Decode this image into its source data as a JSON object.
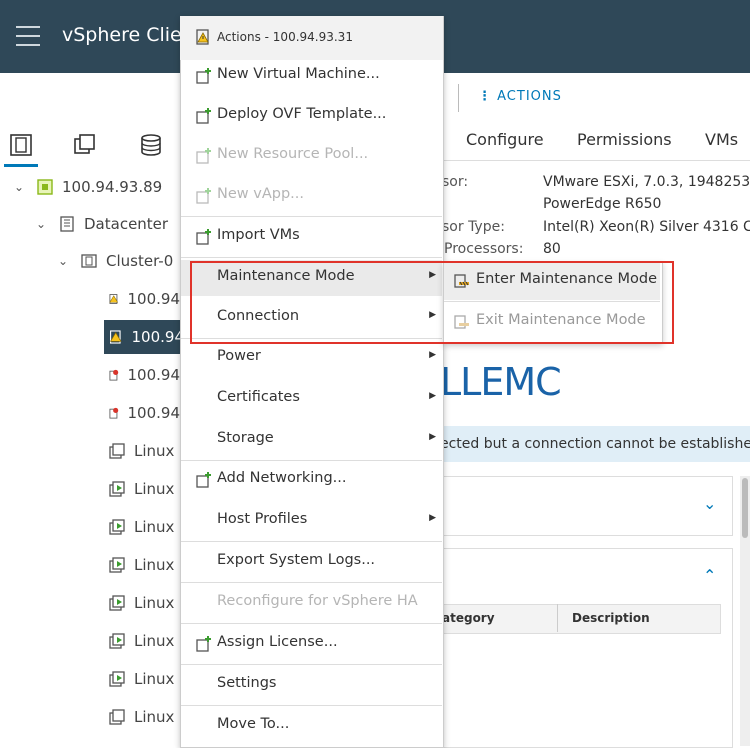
{
  "header": {
    "app_title": "vSphere Clier",
    "menu_icon": "hamburger-icon"
  },
  "navigator": {
    "icons": [
      "hosts-and-clusters-icon",
      "vms-and-templates-icon",
      "storage-icon"
    ],
    "tree": [
      {
        "label": "100.94.93.89",
        "icon": "vcenter-icon"
      },
      {
        "label": "Datacenter",
        "icon": "datacenter-icon"
      },
      {
        "label": "Cluster-0",
        "icon": "cluster-icon"
      },
      {
        "label": "100.94",
        "icon": "host-warning-icon"
      },
      {
        "label": "100.94",
        "icon": "host-warning-icon",
        "selected": true
      },
      {
        "label": "100.94",
        "icon": "host-error-icon"
      },
      {
        "label": "100.94",
        "icon": "host-error-icon"
      },
      {
        "label": "Linux",
        "icon": "vm-icon"
      },
      {
        "label": "Linux",
        "icon": "vm-running-icon"
      },
      {
        "label": "Linux",
        "icon": "vm-running-icon"
      },
      {
        "label": "Linux",
        "icon": "vm-running-icon"
      },
      {
        "label": "Linux",
        "icon": "vm-running-icon"
      },
      {
        "label": "Linux",
        "icon": "vm-running-icon"
      },
      {
        "label": "Linux",
        "icon": "vm-running-icon"
      },
      {
        "label": "Linux",
        "icon": "vm-icon"
      }
    ]
  },
  "main": {
    "actions_label": "ACTIONS",
    "tabs": [
      "Configure",
      "Permissions",
      "VMs"
    ],
    "summary": {
      "hypervisor_label": "sor:",
      "hypervisor_value": "VMware ESXi, 7.0.3, 1948253",
      "model_value": "PowerEdge R650",
      "processor_type_label": "sor Type:",
      "processor_type_value": "Intel(R) Xeon(R) Silver 4316 C",
      "logical_processors_label": "Processors:",
      "logical_processors_value": "80"
    },
    "logo_text": "LLEMC",
    "banner_text": "ected but a connection cannot be establishe",
    "table": {
      "columns": [
        "ategory",
        "Description"
      ]
    }
  },
  "context_menu": {
    "title": "Actions - 100.94.93.31",
    "items": [
      {
        "label": "New Virtual Machine...",
        "disabled": false
      },
      {
        "label": "Deploy OVF Template...",
        "disabled": false
      },
      {
        "label": "New Resource Pool...",
        "disabled": true
      },
      {
        "label": "New vApp...",
        "disabled": true
      },
      {
        "label": "Import VMs",
        "disabled": false
      },
      {
        "label": "Maintenance Mode",
        "submenu": true
      },
      {
        "label": "Connection",
        "submenu": true
      },
      {
        "label": "Power",
        "submenu": true
      },
      {
        "label": "Certificates",
        "submenu": true
      },
      {
        "label": "Storage",
        "submenu": true
      },
      {
        "label": "Add Networking...",
        "disabled": false
      },
      {
        "label": "Host Profiles",
        "submenu": true
      },
      {
        "label": "Export System Logs...",
        "disabled": false
      },
      {
        "label": "Reconfigure for vSphere HA",
        "disabled": true
      },
      {
        "label": "Assign License...",
        "disabled": false
      },
      {
        "label": "Settings",
        "disabled": false
      },
      {
        "label": "Move To...",
        "disabled": false
      }
    ]
  },
  "submenu": {
    "items": [
      {
        "label": "Enter Maintenance Mode",
        "disabled": false
      },
      {
        "label": "Exit Maintenance Mode",
        "disabled": true
      }
    ]
  },
  "colors": {
    "header_bg": "#2f4858",
    "accent": "#0079b8",
    "highlight_border": "#e0332a"
  }
}
